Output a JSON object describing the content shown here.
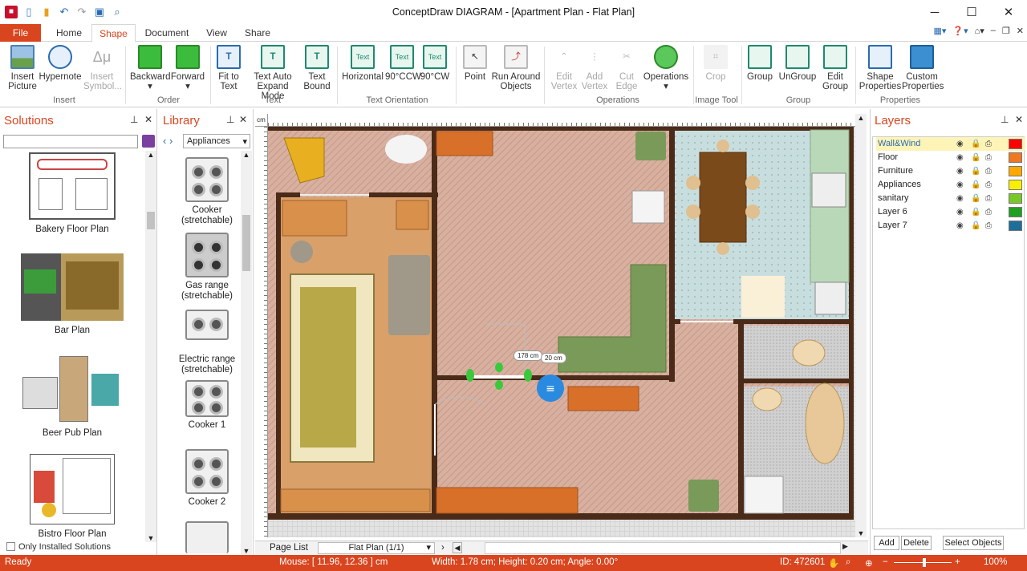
{
  "window": {
    "title": "ConceptDraw DIAGRAM - [Apartment Plan - Flat Plan]"
  },
  "tabs": [
    "File",
    "Home",
    "Shape",
    "Document",
    "View",
    "Share"
  ],
  "ribbon": {
    "buttons": [
      {
        "label1": "Insert",
        "label2": "Picture"
      },
      {
        "label1": "Hypernote",
        "label2": ""
      },
      {
        "label1": "Insert",
        "label2": "Symbol..."
      },
      {
        "label1": "Backward",
        "label2": ""
      },
      {
        "label1": "Forward",
        "label2": ""
      },
      {
        "label1": "Fit to",
        "label2": "Text"
      },
      {
        "label1": "Text Auto",
        "label2": "Expand Mode"
      },
      {
        "label1": "Text",
        "label2": "Bound"
      },
      {
        "label1": "Horizontal",
        "label2": ""
      },
      {
        "label1": "90°CCW",
        "label2": ""
      },
      {
        "label1": "90°CW",
        "label2": ""
      },
      {
        "label1": "Point",
        "label2": ""
      },
      {
        "label1": "Run Around",
        "label2": "Objects"
      },
      {
        "label1": "Edit",
        "label2": "Vertex"
      },
      {
        "label1": "Add",
        "label2": "Vertex"
      },
      {
        "label1": "Cut",
        "label2": "Edge"
      },
      {
        "label1": "Operations",
        "label2": ""
      },
      {
        "label1": "Crop",
        "label2": ""
      },
      {
        "label1": "Group",
        "label2": ""
      },
      {
        "label1": "UnGroup",
        "label2": ""
      },
      {
        "label1": "Edit",
        "label2": "Group"
      },
      {
        "label1": "Shape",
        "label2": "Properties"
      },
      {
        "label1": "Custom",
        "label2": "Properties"
      }
    ],
    "groups": [
      "Insert",
      "Order",
      "Text",
      "Text Orientation",
      "Operations",
      "Image Tool",
      "Group",
      "Properties"
    ]
  },
  "solutions": {
    "title": "Solutions",
    "items": [
      "Bakery Floor Plan",
      "Bar Plan",
      "Beer Pub Plan",
      "Bistro Floor Plan"
    ],
    "only_installed": "Only Installed Solutions"
  },
  "library": {
    "title": "Library",
    "selected": "Appliances",
    "items": [
      {
        "l1": "Cooker",
        "l2": "(stretchable)"
      },
      {
        "l1": "Gas range",
        "l2": "(stretchable)"
      },
      {
        "l1": "Electric range",
        "l2": "(stretchable)"
      },
      {
        "l1": "Cooker 1",
        "l2": ""
      },
      {
        "l1": "Cooker 2",
        "l2": ""
      }
    ]
  },
  "canvas": {
    "dim_label_1": "178 cm",
    "dim_label_2": "20 cm",
    "page_list": "Page List",
    "page_selected": "Flat Plan (1/1)"
  },
  "layers": {
    "title": "Layers",
    "rows": [
      {
        "name": "Wall&Wind",
        "color": "#ff0000"
      },
      {
        "name": "Floor",
        "color": "#f07820"
      },
      {
        "name": "Furniture",
        "color": "#ffa800"
      },
      {
        "name": "Appliances",
        "color": "#f8f000"
      },
      {
        "name": "sanitary",
        "color": "#78c828"
      },
      {
        "name": "Layer 6",
        "color": "#20a020"
      },
      {
        "name": "Layer 7",
        "color": "#1e6e9a"
      }
    ],
    "add": "Add",
    "delete": "Delete",
    "select": "Select Objects"
  },
  "status": {
    "ready": "Ready",
    "mouse": "Mouse: [ 11.96, 12.36 ] cm",
    "size": "Width: 1.78 cm;  Height: 0.20 cm;  Angle: 0.00°",
    "id": "ID: 472601",
    "zoom": "100%"
  },
  "colors": {
    "accent": "#d9451f"
  }
}
